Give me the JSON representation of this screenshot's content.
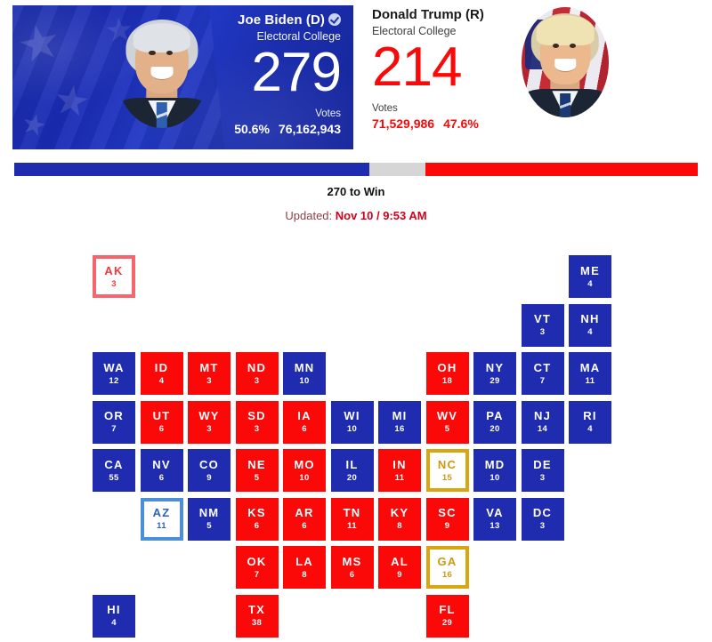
{
  "header": {
    "democrat": {
      "name": "Joe Biden (D)",
      "winner_badge": "check-circle-icon",
      "ec_label": "Electoral College",
      "ec_votes": "279",
      "votes_label": "Votes",
      "percent": "50.6%",
      "popular_votes": "76,162,943",
      "color": "#1f2cb0"
    },
    "republican": {
      "name": "Donald Trump (R)",
      "ec_label": "Electoral College",
      "ec_votes": "214",
      "votes_label": "Votes",
      "percent": "47.6%",
      "popular_votes": "71,529,986",
      "color": "#fb0808"
    }
  },
  "bar": {
    "dem_width_pct": 52.0,
    "undecided_width_pct": 8.2,
    "rep_width_pct": 39.8,
    "dem_color": "#1f2cb0",
    "undecided_color": "#d6d6d6",
    "rep_color": "#fb0808"
  },
  "to_win": "270 to Win",
  "updated": {
    "label": "Updated:",
    "timestamp": "Nov 10 / 9:53 AM"
  },
  "map": {
    "legend_colors": {
      "dem": "#1f2cb0",
      "rep": "#fb0808",
      "tossup": "#d9a612",
      "lean_dem": "#4d8fd6",
      "lean_rep": "#f4666b"
    },
    "states": [
      {
        "abbr": "AK",
        "ev": "3",
        "status": "lean-rep",
        "col": 0,
        "row": 0
      },
      {
        "abbr": "ME",
        "ev": "4",
        "status": "dem",
        "col": 10,
        "row": 0
      },
      {
        "abbr": "VT",
        "ev": "3",
        "status": "dem",
        "col": 9,
        "row": 1
      },
      {
        "abbr": "NH",
        "ev": "4",
        "status": "dem",
        "col": 10,
        "row": 1
      },
      {
        "abbr": "WA",
        "ev": "12",
        "status": "dem",
        "col": 0,
        "row": 2
      },
      {
        "abbr": "ID",
        "ev": "4",
        "status": "rep",
        "col": 1,
        "row": 2
      },
      {
        "abbr": "MT",
        "ev": "3",
        "status": "rep",
        "col": 2,
        "row": 2
      },
      {
        "abbr": "ND",
        "ev": "3",
        "status": "rep",
        "col": 3,
        "row": 2
      },
      {
        "abbr": "MN",
        "ev": "10",
        "status": "dem",
        "col": 4,
        "row": 2
      },
      {
        "abbr": "OH",
        "ev": "18",
        "status": "rep",
        "col": 7,
        "row": 2
      },
      {
        "abbr": "NY",
        "ev": "29",
        "status": "dem",
        "col": 8,
        "row": 2
      },
      {
        "abbr": "CT",
        "ev": "7",
        "status": "dem",
        "col": 9,
        "row": 2
      },
      {
        "abbr": "MA",
        "ev": "11",
        "status": "dem",
        "col": 10,
        "row": 2
      },
      {
        "abbr": "OR",
        "ev": "7",
        "status": "dem",
        "col": 0,
        "row": 3
      },
      {
        "abbr": "UT",
        "ev": "6",
        "status": "rep",
        "col": 1,
        "row": 3
      },
      {
        "abbr": "WY",
        "ev": "3",
        "status": "rep",
        "col": 2,
        "row": 3
      },
      {
        "abbr": "SD",
        "ev": "3",
        "status": "rep",
        "col": 3,
        "row": 3
      },
      {
        "abbr": "IA",
        "ev": "6",
        "status": "rep",
        "col": 4,
        "row": 3
      },
      {
        "abbr": "WI",
        "ev": "10",
        "status": "dem",
        "col": 5,
        "row": 3
      },
      {
        "abbr": "MI",
        "ev": "16",
        "status": "dem",
        "col": 6,
        "row": 3
      },
      {
        "abbr": "WV",
        "ev": "5",
        "status": "rep",
        "col": 7,
        "row": 3
      },
      {
        "abbr": "PA",
        "ev": "20",
        "status": "dem",
        "col": 8,
        "row": 3
      },
      {
        "abbr": "NJ",
        "ev": "14",
        "status": "dem",
        "col": 9,
        "row": 3
      },
      {
        "abbr": "RI",
        "ev": "4",
        "status": "dem",
        "col": 10,
        "row": 3
      },
      {
        "abbr": "CA",
        "ev": "55",
        "status": "dem",
        "col": 0,
        "row": 4
      },
      {
        "abbr": "NV",
        "ev": "6",
        "status": "dem",
        "col": 1,
        "row": 4
      },
      {
        "abbr": "CO",
        "ev": "9",
        "status": "dem",
        "col": 2,
        "row": 4
      },
      {
        "abbr": "NE",
        "ev": "5",
        "status": "rep",
        "col": 3,
        "row": 4
      },
      {
        "abbr": "MO",
        "ev": "10",
        "status": "rep",
        "col": 4,
        "row": 4
      },
      {
        "abbr": "IL",
        "ev": "20",
        "status": "dem",
        "col": 5,
        "row": 4
      },
      {
        "abbr": "IN",
        "ev": "11",
        "status": "rep",
        "col": 6,
        "row": 4
      },
      {
        "abbr": "NC",
        "ev": "15",
        "status": "toss",
        "col": 7,
        "row": 4
      },
      {
        "abbr": "MD",
        "ev": "10",
        "status": "dem",
        "col": 8,
        "row": 4
      },
      {
        "abbr": "DE",
        "ev": "3",
        "status": "dem",
        "col": 9,
        "row": 4
      },
      {
        "abbr": "AZ",
        "ev": "11",
        "status": "lean-dem",
        "col": 1,
        "row": 5
      },
      {
        "abbr": "NM",
        "ev": "5",
        "status": "dem",
        "col": 2,
        "row": 5
      },
      {
        "abbr": "KS",
        "ev": "6",
        "status": "rep",
        "col": 3,
        "row": 5
      },
      {
        "abbr": "AR",
        "ev": "6",
        "status": "rep",
        "col": 4,
        "row": 5
      },
      {
        "abbr": "TN",
        "ev": "11",
        "status": "rep",
        "col": 5,
        "row": 5
      },
      {
        "abbr": "KY",
        "ev": "8",
        "status": "rep",
        "col": 6,
        "row": 5
      },
      {
        "abbr": "SC",
        "ev": "9",
        "status": "rep",
        "col": 7,
        "row": 5
      },
      {
        "abbr": "VA",
        "ev": "13",
        "status": "dem",
        "col": 8,
        "row": 5
      },
      {
        "abbr": "DC",
        "ev": "3",
        "status": "dem",
        "col": 9,
        "row": 5
      },
      {
        "abbr": "OK",
        "ev": "7",
        "status": "rep",
        "col": 3,
        "row": 6
      },
      {
        "abbr": "LA",
        "ev": "8",
        "status": "rep",
        "col": 4,
        "row": 6
      },
      {
        "abbr": "MS",
        "ev": "6",
        "status": "rep",
        "col": 5,
        "row": 6
      },
      {
        "abbr": "AL",
        "ev": "9",
        "status": "rep",
        "col": 6,
        "row": 6
      },
      {
        "abbr": "GA",
        "ev": "16",
        "status": "toss",
        "col": 7,
        "row": 6
      },
      {
        "abbr": "HI",
        "ev": "4",
        "status": "dem",
        "col": 0,
        "row": 7
      },
      {
        "abbr": "TX",
        "ev": "38",
        "status": "rep",
        "col": 3,
        "row": 7
      },
      {
        "abbr": "FL",
        "ev": "29",
        "status": "rep",
        "col": 7,
        "row": 7
      }
    ]
  }
}
